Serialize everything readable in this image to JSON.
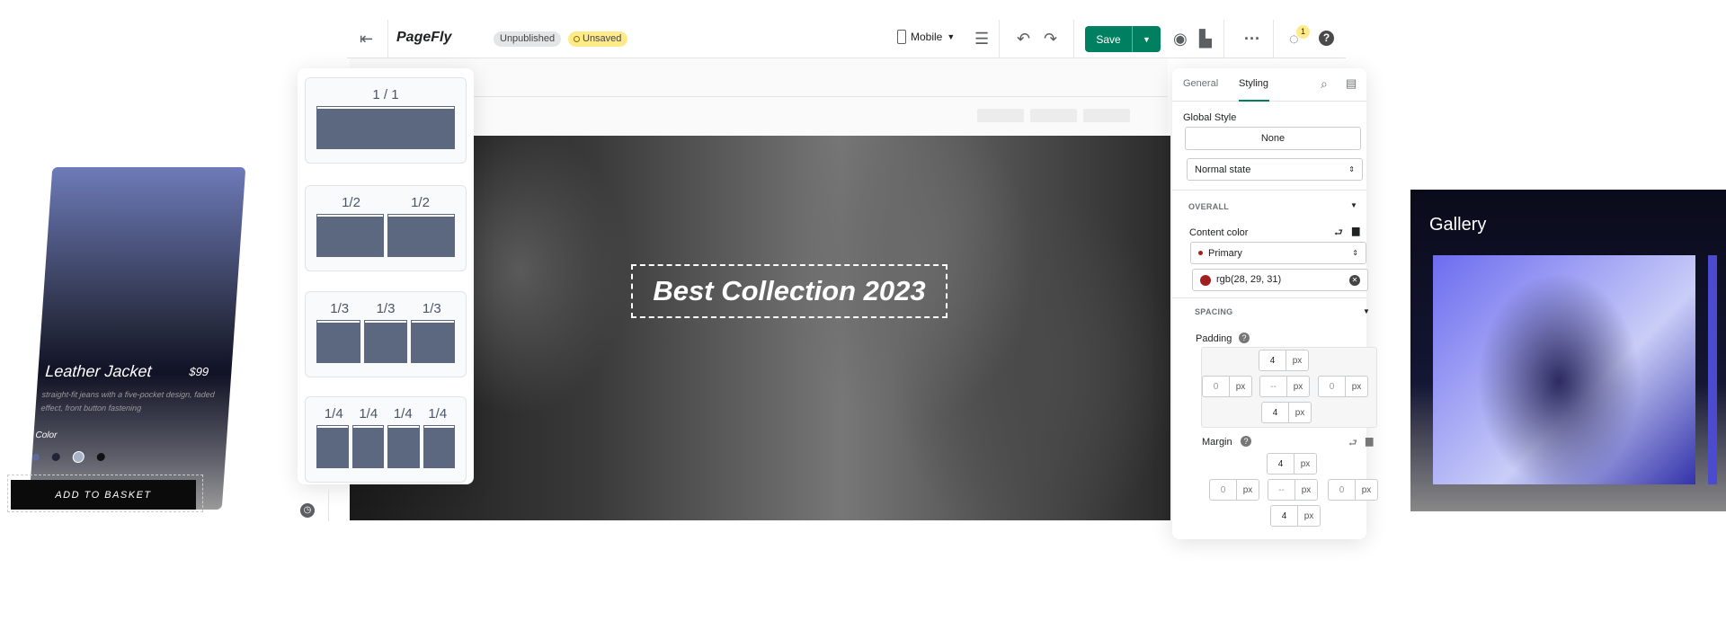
{
  "topbar": {
    "brand": "PageFly",
    "status_published": "Unpublished",
    "status_saved": "Unsaved",
    "device": "Mobile",
    "save_label": "Save",
    "notification_count": "1"
  },
  "canvas": {
    "hero_title": "Best Collection 2023"
  },
  "layouts": [
    {
      "labels": [
        "1 / 1"
      ]
    },
    {
      "labels": [
        "1/2",
        "1/2"
      ]
    },
    {
      "labels": [
        "1/3",
        "1/3",
        "1/3"
      ]
    },
    {
      "labels": [
        "1/4",
        "1/4",
        "1/4",
        "1/4"
      ]
    }
  ],
  "product": {
    "name": "Leather Jacket",
    "price": "$99",
    "description": "straight-fit jeans with a five-pocket design, faded effect, front button fastening",
    "color_label": "Color",
    "swatches": [
      "#5d6a9a",
      "#222538",
      "#a9b3c8",
      "#111111"
    ],
    "cta": "ADD TO BASKET"
  },
  "panel": {
    "tabs": [
      "General",
      "Styling"
    ],
    "active_tab": "Styling",
    "global_style_label": "Global Style",
    "global_style_value": "None",
    "state": "Normal state",
    "overall": "OVERALL",
    "content_color_label": "Content color",
    "color_token": "Primary",
    "color_value": "rgb(28, 29, 31)",
    "color_swatch": "#a21f1f",
    "spacing": "SPACING",
    "padding_label": "Padding",
    "margin_label": "Margin",
    "padding": {
      "top": "4",
      "left": "0",
      "center": "--",
      "right": "0",
      "bottom": "4",
      "unit": "px"
    },
    "margin": {
      "top": "4",
      "left": "0",
      "center": "--",
      "right": "0",
      "bottom": "4",
      "unit": "px"
    }
  },
  "gallery": {
    "title": "Gallery"
  },
  "colors": {
    "accent": "#008060",
    "unsaved_badge": "#ffea8a",
    "unpublished_badge": "#e4e5e7"
  }
}
